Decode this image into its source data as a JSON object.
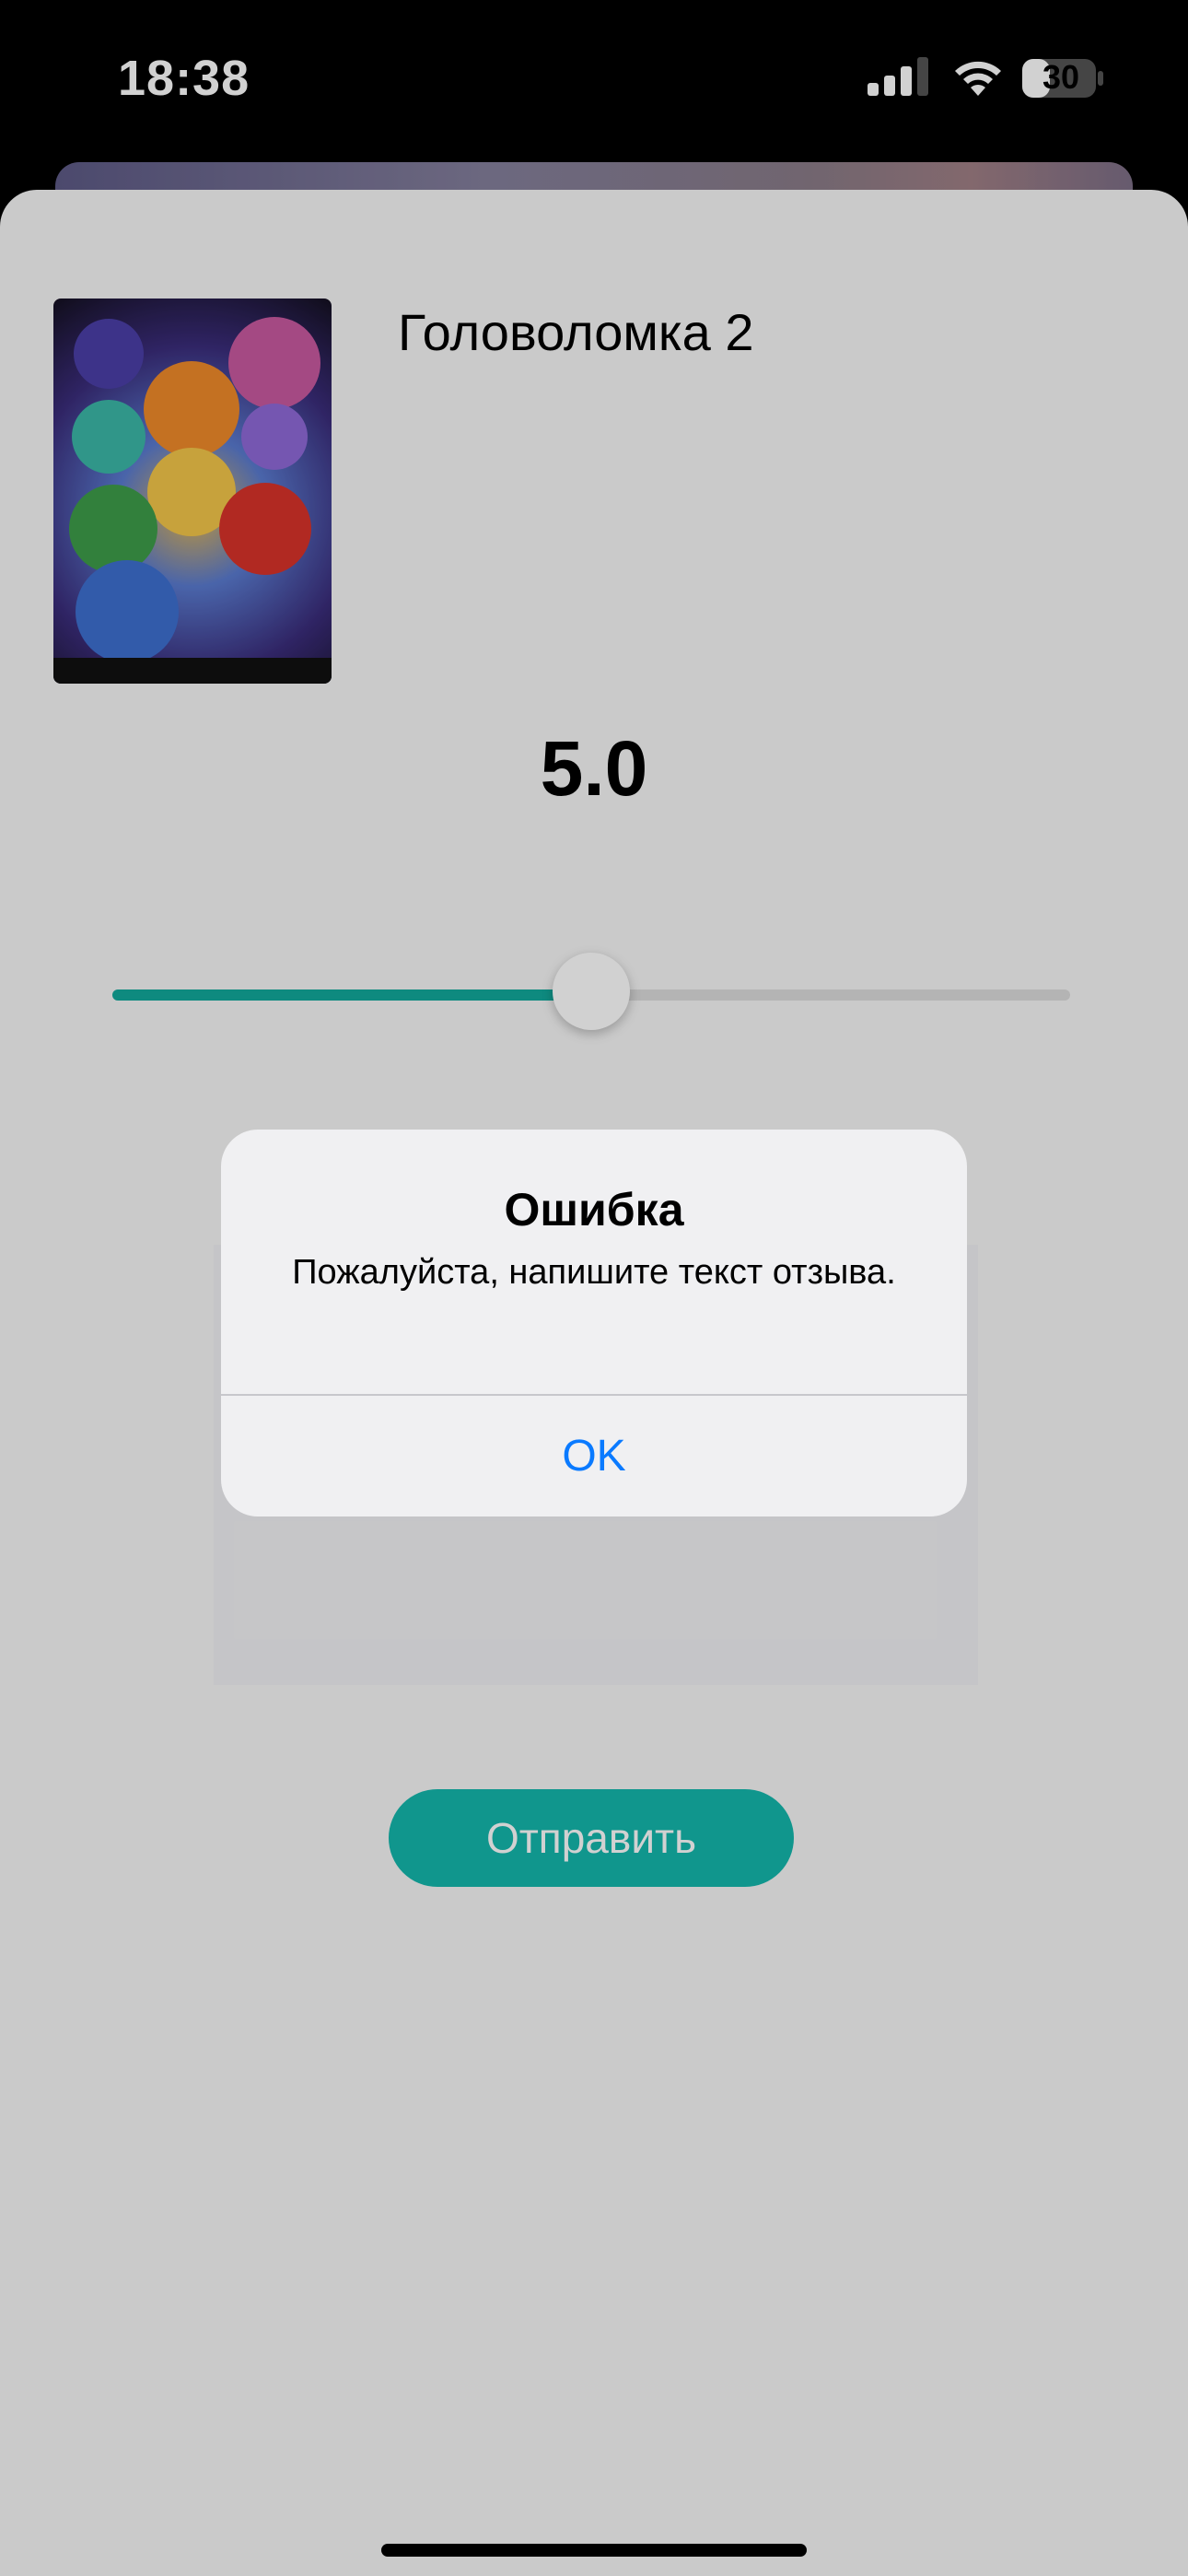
{
  "status_bar": {
    "time": "18:38",
    "battery": "30"
  },
  "movie": {
    "title": "Головоломка 2"
  },
  "rating": {
    "display": "5.0",
    "slider_fraction": 0.5
  },
  "submit": {
    "label": "Отправить"
  },
  "alert": {
    "title": "Ошибка",
    "message": "Пожалуйста, напишите текст отзыва.",
    "ok_label": "OK"
  },
  "colors": {
    "accent": "#14B8AD",
    "link_blue": "#0A7AFF"
  },
  "icons": [
    "signal-icon",
    "wifi-icon",
    "battery-icon"
  ]
}
